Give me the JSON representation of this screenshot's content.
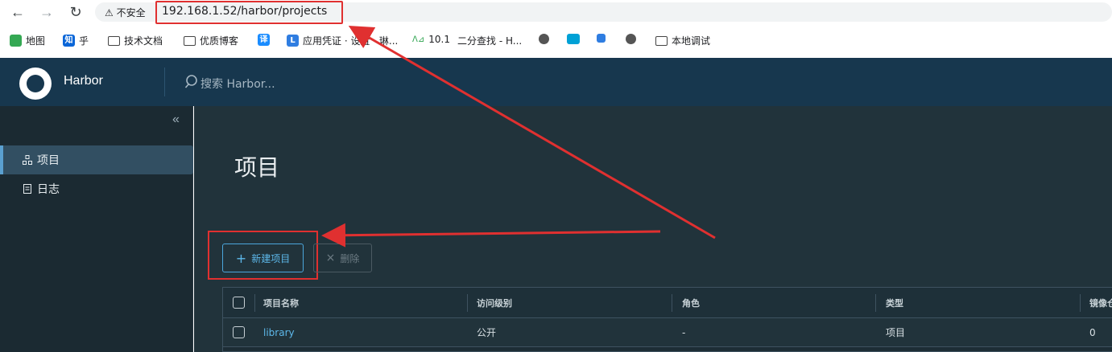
{
  "browser": {
    "security_label": "不安全",
    "url": "192.168.1.52/harbor/projects",
    "bookmarks": [
      {
        "label": "地图",
        "icon": "maps-icon"
      },
      {
        "label": "乎",
        "icon": "zhihu-icon"
      },
      {
        "label": "技术文档",
        "icon": "folder-icon"
      },
      {
        "label": "优质博客",
        "icon": "folder-icon"
      },
      {
        "label": "",
        "icon": "translate-icon"
      },
      {
        "label": "应用凭证 · 设置 · 琳...",
        "icon": "l-app-icon"
      },
      {
        "label": "10.1",
        "icon": "ai-icon"
      },
      {
        "label": "二分查找 - H...",
        "icon": ""
      },
      {
        "label": "",
        "icon": "globe-icon"
      },
      {
        "label": "",
        "icon": "bilibili-icon"
      },
      {
        "label": "",
        "icon": "book-icon"
      },
      {
        "label": "",
        "icon": "globe-icon"
      },
      {
        "label": "本地调试",
        "icon": "folder-icon"
      }
    ]
  },
  "app": {
    "title": "Harbor",
    "search_placeholder": "搜索 Harbor...",
    "brand_color": "#17374e"
  },
  "sidebar": {
    "items": [
      {
        "label": "项目",
        "icon": "projects-icon",
        "active": true
      },
      {
        "label": "日志",
        "icon": "logs-icon",
        "active": false
      }
    ]
  },
  "main": {
    "page_title": "项目",
    "new_project_label": "新建项目",
    "delete_label": "删除",
    "table": {
      "headers": [
        "项目名称",
        "访问级别",
        "角色",
        "类型",
        "镜像仓"
      ],
      "rows": [
        {
          "name": "library",
          "access": "公开",
          "role": "-",
          "type": "项目",
          "repos": "0"
        }
      ]
    }
  },
  "annotation_color": "#e03030"
}
